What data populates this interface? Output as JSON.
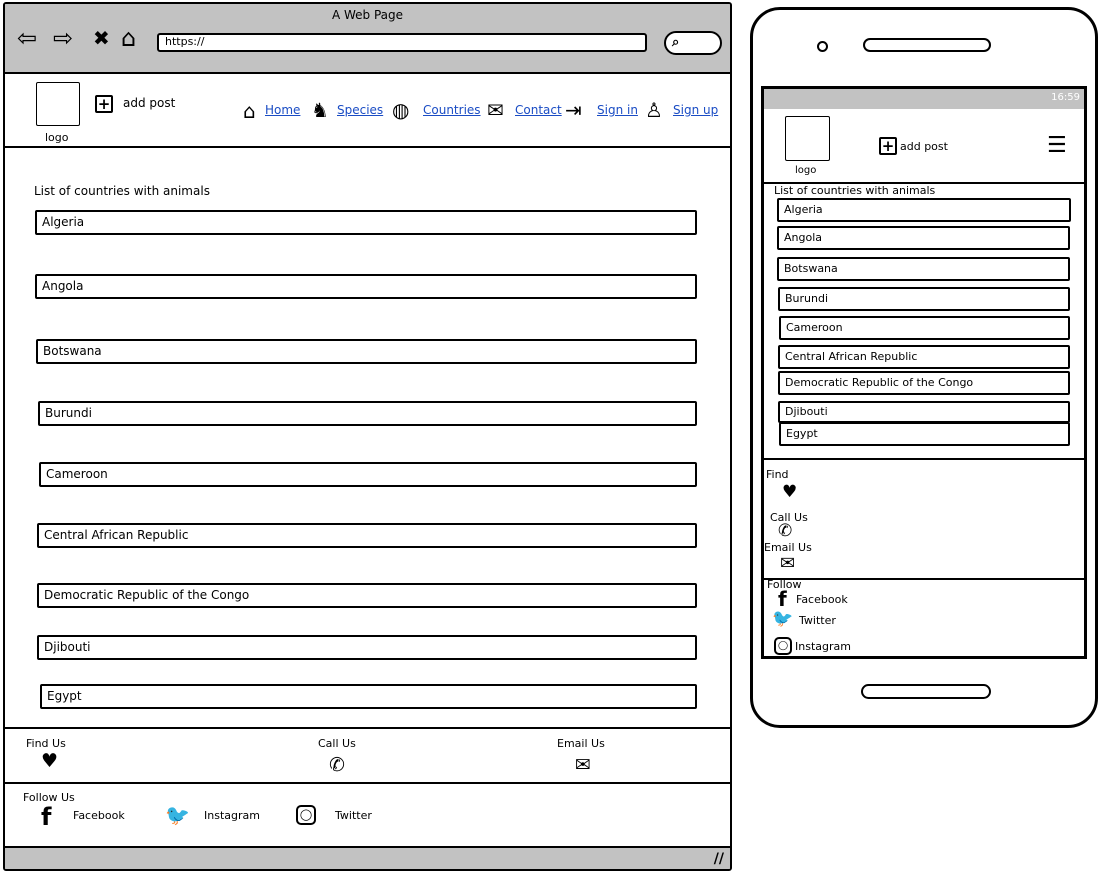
{
  "browser": {
    "title": "A Web Page",
    "url": "https://",
    "nav_icons": [
      "back-arrow-icon",
      "forward-arrow-icon",
      "close-x-icon",
      "home-outline-icon"
    ],
    "search_icon": "search-icon"
  },
  "header": {
    "logo_label": "logo",
    "add_post_label": "add post",
    "nav": [
      {
        "label": "Home",
        "icon": "home-icon"
      },
      {
        "label": "Species",
        "icon": "dog-icon"
      },
      {
        "label": "Countries",
        "icon": "globe-icon"
      },
      {
        "label": "Contact",
        "icon": "envelope-icon"
      },
      {
        "label": "Sign in",
        "icon": "sign-in-icon"
      },
      {
        "label": "Sign up",
        "icon": "add-user-icon"
      }
    ]
  },
  "main": {
    "heading": "List of countries with animals",
    "countries": [
      "Algeria",
      "Angola",
      "Botswana",
      "Burundi",
      "Cameroon",
      "Central African Republic",
      "Democratic Republic of the Congo",
      "Djibouti",
      "Egypt"
    ]
  },
  "footer": {
    "find_us": "Find Us",
    "call_us": "Call Us",
    "email_us": "Email Us",
    "follow_us": "Follow Us",
    "social": [
      "Facebook",
      "Instagram",
      "Twitter"
    ]
  },
  "mobile": {
    "status_time": "16:59",
    "logo_label": "logo",
    "add_post_label": "add post",
    "heading": "List of countries with animals",
    "countries": [
      "Algeria",
      "Angola",
      "Botswana",
      "Burundi",
      "Cameroon",
      "Central African Republic",
      "Democratic Republic of the Congo",
      "Djibouti",
      "Egypt"
    ],
    "find": "Find",
    "call_us": "Call Us",
    "email_us": "Email Us",
    "follow": "Follow",
    "social": [
      "Facebook",
      "Twitter",
      "Instagram"
    ]
  }
}
